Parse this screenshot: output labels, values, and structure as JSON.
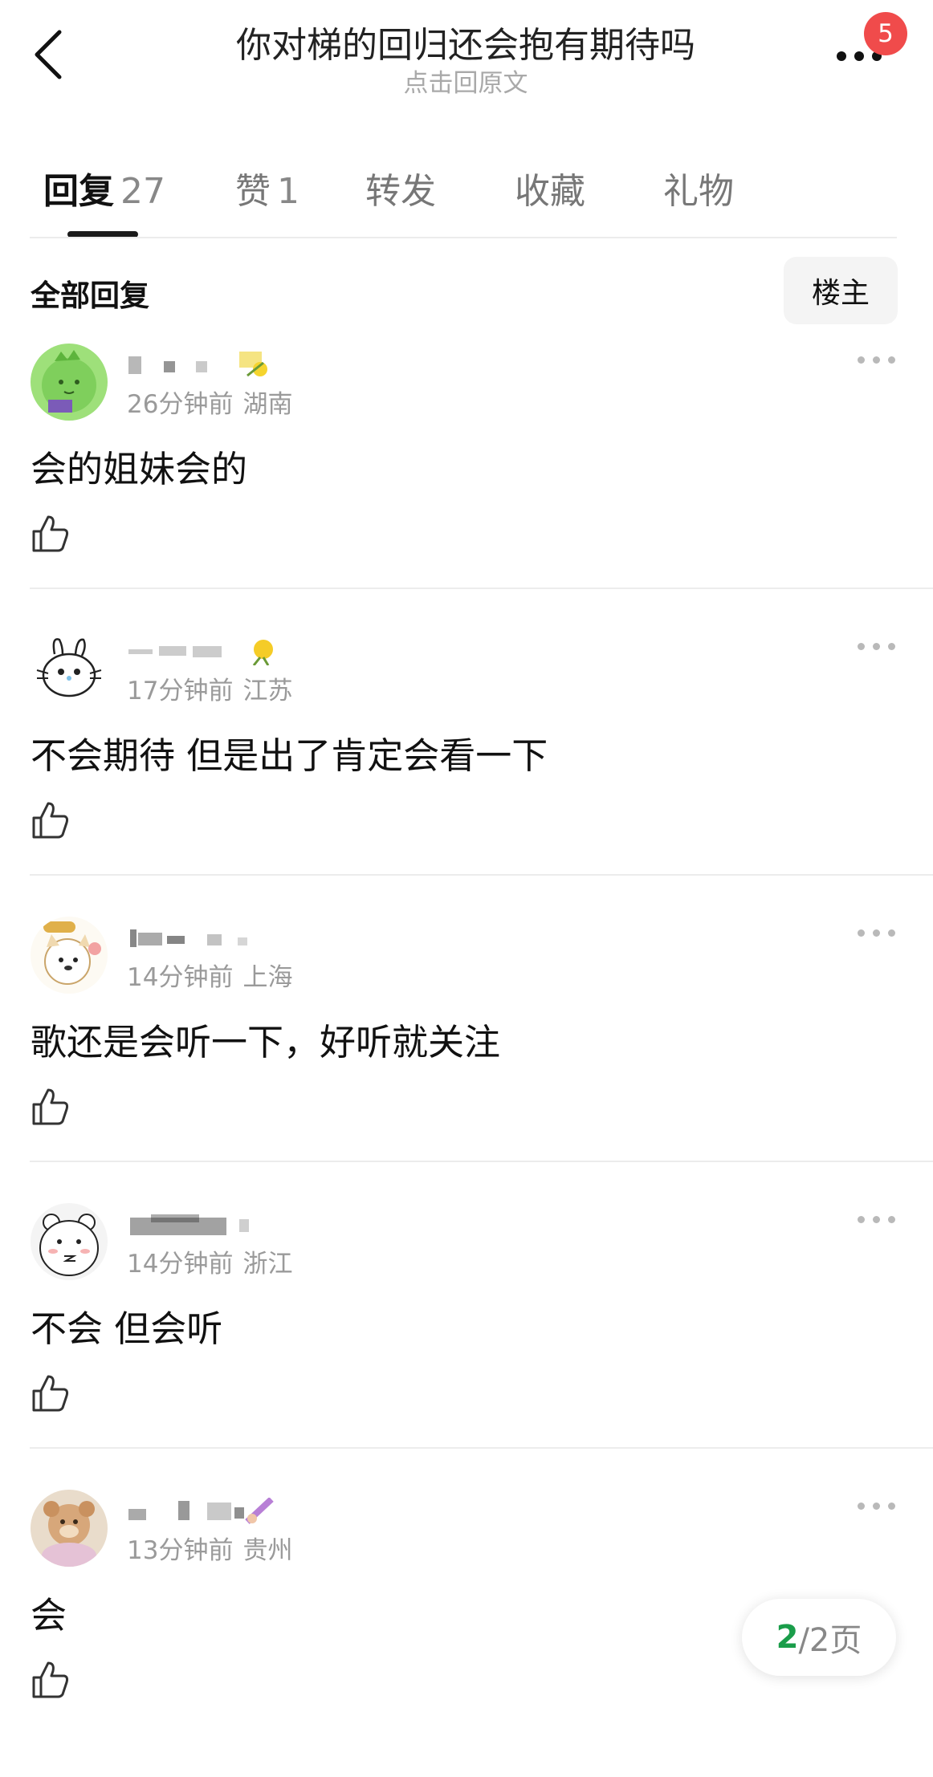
{
  "header": {
    "title": "你对梯的回归还会抱有期待吗",
    "subtitle": "点击回原文",
    "notification_count": "5"
  },
  "tabs": [
    {
      "label": "回复",
      "count": "27",
      "active": true
    },
    {
      "label": "赞",
      "count": "1",
      "active": false
    },
    {
      "label": "转发",
      "count": "",
      "active": false
    },
    {
      "label": "收藏",
      "count": "",
      "active": false
    },
    {
      "label": "礼物",
      "count": "",
      "active": false
    }
  ],
  "section": {
    "title": "全部回复",
    "filter_button": "楼主"
  },
  "comments": [
    {
      "time": "26分钟前",
      "location": "湖南",
      "text": "会的姐妹会的",
      "avatar": "green-dino-avatar"
    },
    {
      "time": "17分钟前",
      "location": "江苏",
      "text": "不会期待 但是出了肯定会看一下",
      "avatar": "doodle-bunny-avatar"
    },
    {
      "time": "14分钟前",
      "location": "上海",
      "text": "歌还是会听一下，好听就关注",
      "avatar": "puppy-sticker-avatar"
    },
    {
      "time": "14分钟前",
      "location": "浙江",
      "text": "不会 但会听",
      "avatar": "white-bear-avatar"
    },
    {
      "time": "13分钟前",
      "location": "贵州",
      "text": "会",
      "avatar": "plush-bear-avatar"
    }
  ],
  "pager": {
    "current": "2",
    "total_text": "/2页"
  },
  "colors": {
    "badge": "#f04b4b",
    "pager_current": "#1a9d4a",
    "divider": "#ececec"
  }
}
